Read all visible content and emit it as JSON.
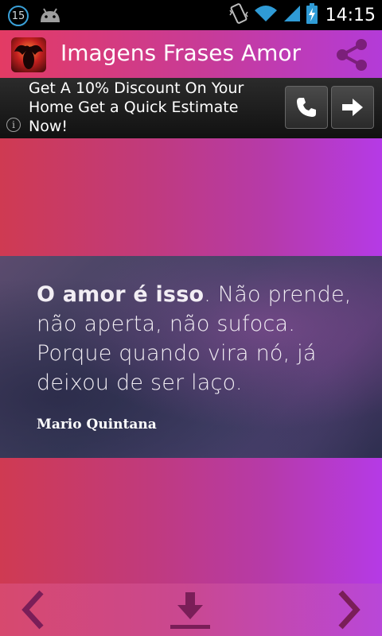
{
  "status_bar": {
    "notification_count": "15",
    "time": "14:15",
    "icons": [
      "notification-count-icon",
      "android-icon",
      "vibrate-icon",
      "wifi-icon",
      "signal-icon",
      "battery-charging-icon"
    ]
  },
  "app_bar": {
    "title": "Imagens Frases Amor",
    "icons": [
      "app-icon",
      "share-icon"
    ]
  },
  "ad": {
    "text": "Get A 10% Discount On Your Home Get a Quick Estimate Now!",
    "info_glyph": "i",
    "icons": [
      "info-icon",
      "phone-icon",
      "arrow-right-icon"
    ]
  },
  "quote": {
    "bold_part": "O amor é isso",
    "rest": ". Não prende, não aperta, não sufoca. Porque quando vira nó, já deixou de ser laço.",
    "author": "Mario Quintana"
  },
  "bottom_bar": {
    "icons": [
      "chevron-left-icon",
      "download-icon",
      "chevron-right-icon"
    ]
  },
  "colors": {
    "accent_start": "#e33b64",
    "accent_end": "#b33bd8"
  }
}
